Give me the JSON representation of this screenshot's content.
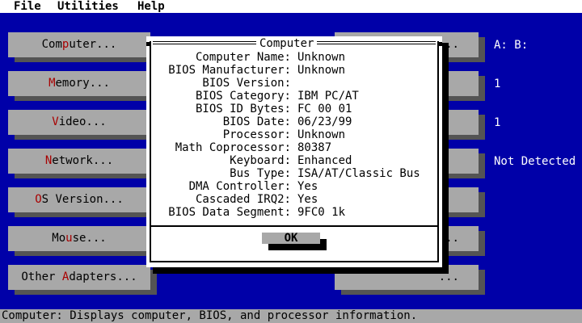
{
  "menu": {
    "file": "File",
    "utilities": "Utilities",
    "help": "Help"
  },
  "buttons": [
    {
      "pre": "Com",
      "hot": "p",
      "post": "uter..."
    },
    {
      "pre": "",
      "hot": "M",
      "post": "emory..."
    },
    {
      "pre": "",
      "hot": "V",
      "post": "ideo..."
    },
    {
      "pre": "",
      "hot": "N",
      "post": "etwork..."
    },
    {
      "pre": "",
      "hot": "O",
      "post": "S Version..."
    },
    {
      "pre": "Mo",
      "hot": "u",
      "post": "se..."
    },
    {
      "pre": "Other ",
      "hot": "A",
      "post": "dapters..."
    }
  ],
  "right_buttons": {
    "b1": "...",
    "b6": "...",
    "b7": "..."
  },
  "right_values": {
    "disk": "A: B:",
    "v2": "1",
    "v3": "1",
    "network": "Not Detected"
  },
  "dialog": {
    "title": "Computer",
    "rows": [
      {
        "label": "Computer Name:",
        "value": "Unknown"
      },
      {
        "label": "BIOS Manufacturer:",
        "value": "Unknown"
      },
      {
        "label": "BIOS Version:",
        "value": ""
      },
      {
        "label": "BIOS Category:",
        "value": "IBM PC/AT"
      },
      {
        "label": "BIOS ID Bytes:",
        "value": "FC 00 01"
      },
      {
        "label": "BIOS Date:",
        "value": "06/23/99"
      },
      {
        "label": "Processor:",
        "value": "Unknown"
      },
      {
        "label": "Math Coprocessor:",
        "value": "80387"
      },
      {
        "label": "Keyboard:",
        "value": "Enhanced"
      },
      {
        "label": "Bus Type:",
        "value": "ISA/AT/Classic Bus"
      },
      {
        "label": "DMA Controller:",
        "value": "Yes"
      },
      {
        "label": "Cascaded IRQ2:",
        "value": "Yes"
      },
      {
        "label": "BIOS Data Segment:",
        "value": "9FC0 1k"
      }
    ],
    "ok_label": "OK"
  },
  "status": "Computer: Displays computer, BIOS, and processor information."
}
